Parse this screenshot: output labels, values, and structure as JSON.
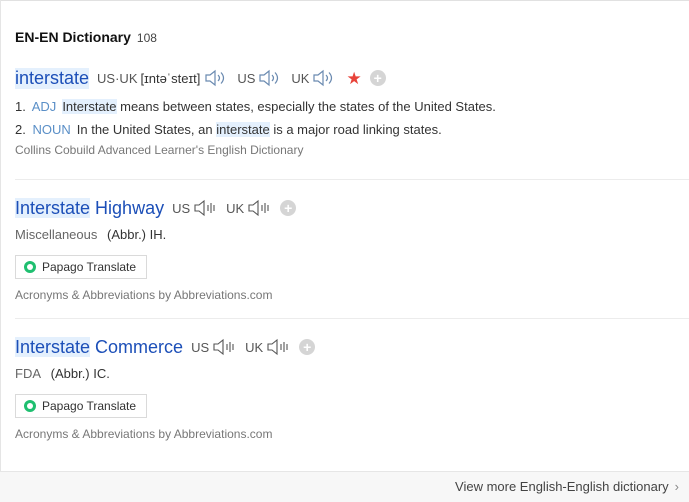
{
  "header": {
    "title": "EN-EN Dictionary",
    "count": "108"
  },
  "entries": [
    {
      "word": "interstate",
      "phon_label_us_uk": "US·UK",
      "phonetic": "[ɪntəˈsteɪt]",
      "us_label": "US",
      "uk_label": "UK",
      "definitions": [
        {
          "num": "1.",
          "pos": "ADJ",
          "text_before": "",
          "hl": "Interstate",
          "text_after": " means between states, especially the states of the United States."
        },
        {
          "num": "2.",
          "pos": "NOUN",
          "text_before": "In the United States, an ",
          "hl": "interstate",
          "text_after": " is a major road linking states."
        }
      ],
      "source": "Collins Cobuild Advanced Learner's English Dictionary"
    },
    {
      "word_hl": "Interstate",
      "word_rest": " Highway",
      "us_label": "US",
      "uk_label": "UK",
      "category": "Miscellaneous",
      "abbr": "(Abbr.) IH.",
      "papago": "Papago Translate",
      "source": "Acronyms & Abbreviations by Abbreviations.com"
    },
    {
      "word_hl": "Interstate",
      "word_rest": " Commerce",
      "us_label": "US",
      "uk_label": "UK",
      "category": "FDA",
      "abbr": "(Abbr.) IC.",
      "papago": "Papago Translate",
      "source": "Acronyms & Abbreviations by Abbreviations.com"
    }
  ],
  "footer": {
    "more": "View more English-English dictionary",
    "chevron": "›"
  },
  "icons": {
    "speaker": "speaker-icon",
    "star": "star-icon",
    "plus": "plus-icon",
    "papago": "papago-logo-icon"
  },
  "colors": {
    "headword": "#1c4fb8",
    "highlight": "#e4f0fd",
    "pos": "#5a8fc7",
    "star": "#e8433a"
  }
}
